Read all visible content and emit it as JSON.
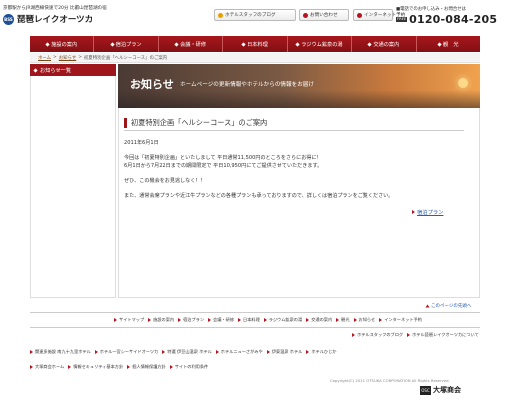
{
  "header": {
    "tagline": "京都駅からJR湖西線快速で20分 比叡山琵琶湖の宿",
    "logo_mark": "BSS",
    "site_name": "琵琶レイクオーツカ",
    "staff_blog": "ホテルスタッフのブログ",
    "contact": "お問い合わせ",
    "reserve": "インターネット予約",
    "phone_label": "■電話でのお申し込み・お問合せは",
    "phone_badge": "FREE",
    "phone_number": "0120-084-205"
  },
  "nav": {
    "items": [
      "施設の案内",
      "宿泊プラン",
      "会議・研修",
      "日本料理",
      "ラジウム鉱泉の湯",
      "交通の案内",
      "観　光"
    ]
  },
  "breadcrumb": {
    "home": "ホーム",
    "news": "お知らせ",
    "current": "初夏特別企画「ヘルシーコース」のご案内"
  },
  "sidebar": {
    "news_list": "お知らせ一覧"
  },
  "hero": {
    "title": "お知らせ",
    "subtitle": "ホームページの更新情報やホテルからの情報をお届け"
  },
  "article": {
    "title": "初夏特別企画「ヘルシーコース」のご案内",
    "date": "2011年6月1日",
    "p1": "今回は「初夏特別企画」といたしまして 平日通常11,500円のところをさらにお得に！",
    "p2": "6月1日から7月22日までの期間限定で 平日10,950円にてご提供させていただきます。",
    "p3": "ぜひ、この機会をお見逃しなく！！",
    "p4": "また、通常会席プランや近江牛プランなどの各種プランも承っておりますので、詳しくは宿泊プランをご覧ください。",
    "details_link": "宿泊プラン"
  },
  "footer": {
    "page_top": "このページの先頭へ",
    "row1": [
      "サイトマップ",
      "施設の案内",
      "宿泊プラン",
      "会議・研修",
      "日本料理",
      "ラジウム鉱泉の湯",
      "交通の案内",
      "観光",
      "お知らせ",
      "インターネット予約"
    ],
    "row2": [
      "ホテルスタッフのブログ",
      "ホテル琵琶レイクオーツカについて"
    ],
    "row3": [
      "関連多施設 南九十九里ホテル",
      "ホテル一宮シーサイドオーツカ",
      "特選 伊豆山温泉 ホテル",
      "ホテルニューさがみや",
      "伊東温泉 ホテル",
      "ホテルひじか"
    ],
    "row4": [
      "大塚商会ホーム",
      "情報セキュリティ基本方針",
      "個人情報保護方針",
      "サイトの利用条件"
    ],
    "copyright": "Copyright(C) 2011 OTSUKA CORPORATION All Rights Reserved.",
    "otsuka_mark": "OSC",
    "otsuka_name": "大塚商会"
  }
}
